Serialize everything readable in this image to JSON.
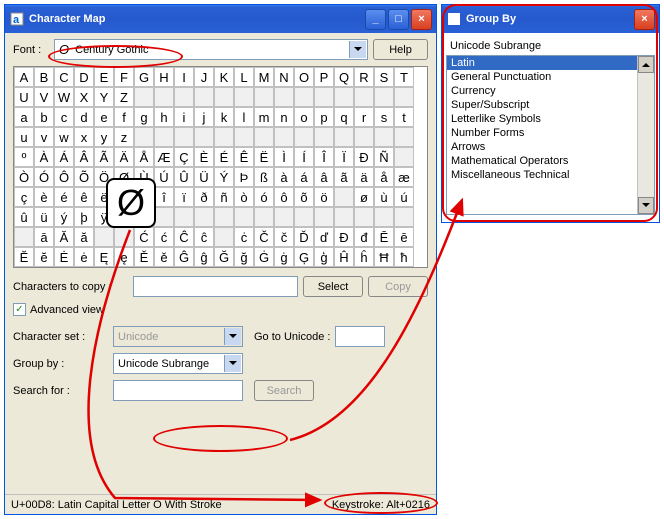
{
  "main": {
    "title": "Character Map",
    "font_label": "Font :",
    "font_sample": "O",
    "font_name": "Century Gothic",
    "help": "Help",
    "grid": [
      "ABCDEFGHIJKLMNOPQRST",
      "UVWXYZ              ",
      "abcdefghijklmnopqrst",
      "uvwxyz              ",
      "ºÀÁÂÃÄÅÆÇÈÉÊËÌÍÎÏÐÑ ",
      "ÒÓÔÕÖØÙÚÛÜÝÞßàáâãäåæ",
      "çèéêëìíîïðñòóôõö øùú",
      "ûüýþÿ               ",
      " āĂă  ĆćĈĉ ċČčĎďĐđĒē",
      "ĔĕĖėĘęĚěĜĝĞğĠġĢģĤĥĦħ"
    ],
    "chars_to_copy_label": "Characters to copy :",
    "select_btn": "Select",
    "copy_btn": "Copy",
    "advanced_view": "Advanced view",
    "charset_label": "Character set :",
    "charset_value": "Unicode",
    "goto_label": "Go to Unicode :",
    "groupby_label": "Group by :",
    "groupby_value": "Unicode Subrange",
    "search_label": "Search for :",
    "search_btn": "Search",
    "status_left": "U+00D8: Latin Capital Letter O With Stroke",
    "status_right": "Keystroke: Alt+0216",
    "zoom_char": "Ø"
  },
  "group": {
    "title": "Group By",
    "heading": "Unicode Subrange",
    "items": [
      "Latin",
      "General Punctuation",
      "Currency",
      "Super/Subscript",
      "Letterlike Symbols",
      "Number Forms",
      "Arrows",
      "Mathematical Operators",
      "Miscellaneous Technical"
    ],
    "selected": 0
  }
}
